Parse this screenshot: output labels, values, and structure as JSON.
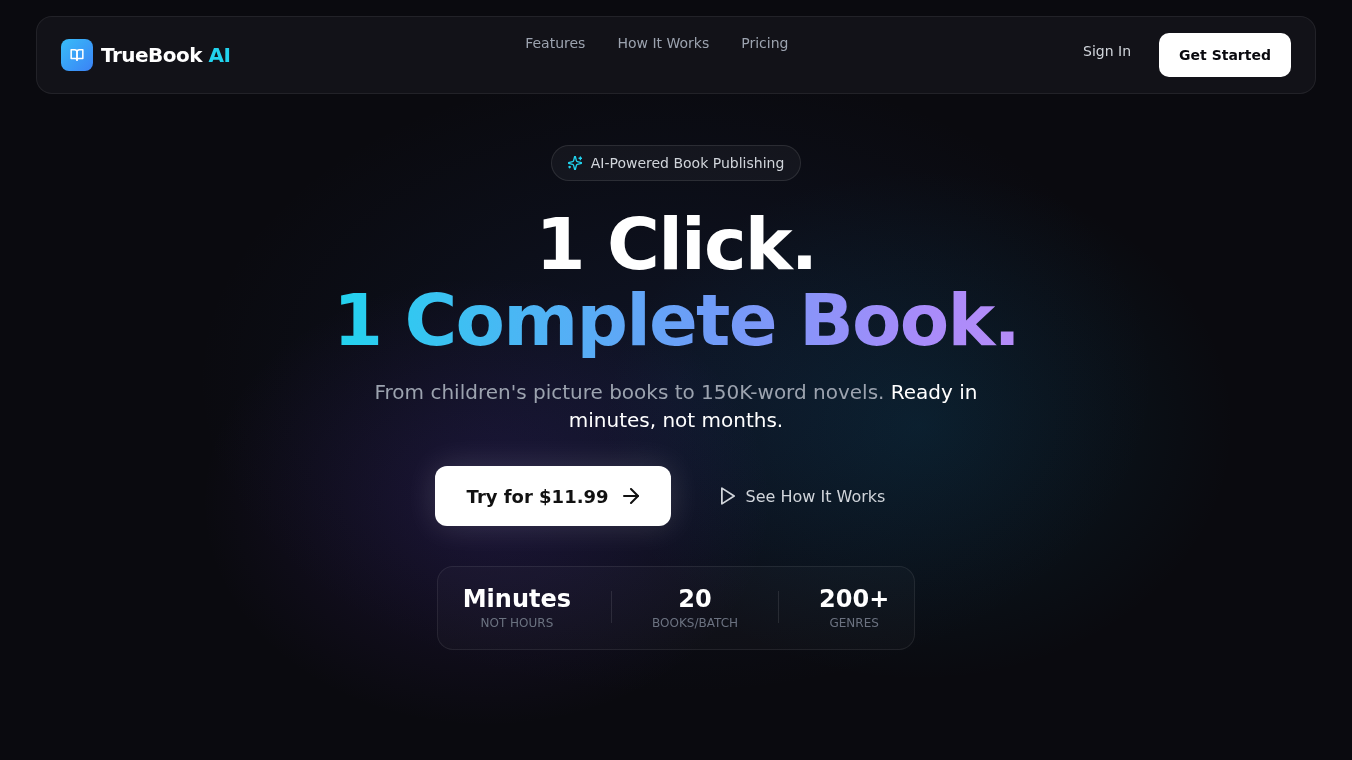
{
  "nav": {
    "brand": {
      "name": "TrueBook",
      "accent": "AI"
    },
    "links": [
      "Features",
      "How It Works",
      "Pricing"
    ],
    "sign_in": "Sign In",
    "cta": "Get Started"
  },
  "hero": {
    "badge": "AI-Powered Book Publishing",
    "headline": [
      {
        "text": "1 Click.",
        "kind": "plain"
      },
      {
        "text": "1 Complete Book.",
        "kind": "gradient"
      }
    ],
    "subtitle": {
      "lead": "From children's picture books to 150K-word novels.",
      "emphasis": "Ready in minutes, not months."
    },
    "primary_button": "Try for $11.99",
    "secondary_button": "See How It Works",
    "stats": [
      {
        "value": "Minutes",
        "label": "NOT HOURS"
      },
      {
        "value": "20",
        "label": "BOOKS/BATCH"
      },
      {
        "value": "200+",
        "label": "GENRES"
      }
    ]
  }
}
